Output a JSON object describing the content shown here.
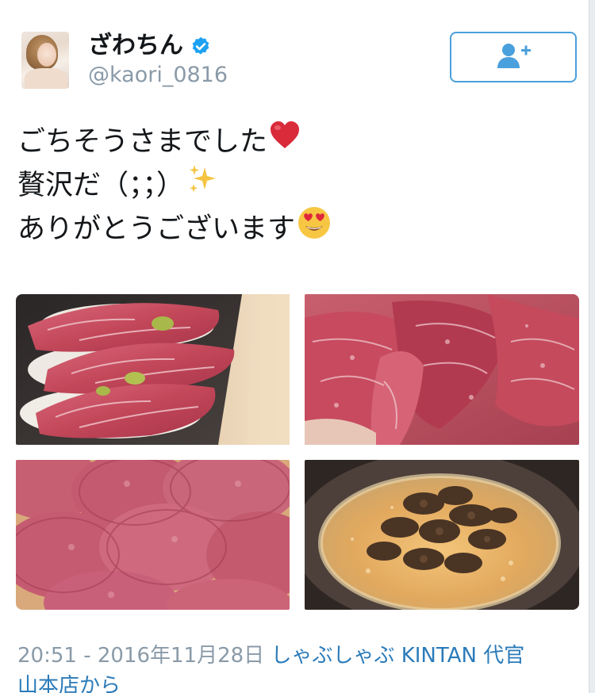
{
  "user": {
    "display_name": "ざわちん",
    "handle": "@kaori_0816",
    "verified": true
  },
  "follow_button": {
    "icon": "add-user-icon",
    "color": "#4aa0dc"
  },
  "tweet": {
    "lines": [
      {
        "text": "ごちそうさまでした",
        "emoji": "red-heart"
      },
      {
        "text": "贅沢だ（；；）",
        "emoji": "sparkles"
      },
      {
        "text": "ありがとうございます",
        "emoji": "heart-eyes-face"
      }
    ]
  },
  "photos": [
    {
      "subject": "wagyu-nigiri-sushi"
    },
    {
      "subject": "sliced-marbled-beef"
    },
    {
      "subject": "sliced-beef-tongue"
    },
    {
      "subject": "truffle-risotto"
    }
  ],
  "meta": {
    "timestamp": "20:51 - 2016年11月28日",
    "source_line1": "しゃぶしゃぶ KINTAN 代官",
    "source_line2": "山本店から"
  },
  "colors": {
    "link": "#2b7bb9",
    "muted": "#8a9aa8",
    "verified": "#1da1f2"
  }
}
